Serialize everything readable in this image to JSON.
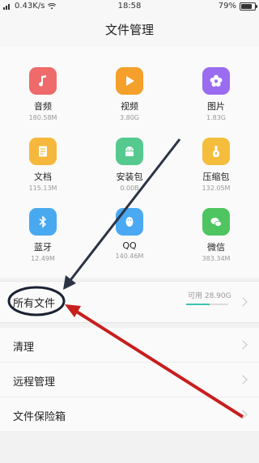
{
  "status_bar": {
    "speed": "0.43K/s",
    "time": "18:58",
    "battery": "79%"
  },
  "title": "文件管理",
  "categories": [
    {
      "label": "音频",
      "size": "180.58M",
      "icon": "music-note-icon",
      "color": "#ef6a6a"
    },
    {
      "label": "视频",
      "size": "3.80G",
      "icon": "play-icon",
      "color": "#f5a02a"
    },
    {
      "label": "图片",
      "size": "1.83G",
      "icon": "flower-icon",
      "color": "#9a6cf0"
    },
    {
      "label": "文档",
      "size": "115.13M",
      "icon": "document-icon",
      "color": "#f5b83c"
    },
    {
      "label": "安装包",
      "size": "0.00B",
      "icon": "android-icon",
      "color": "#56c98f"
    },
    {
      "label": "压缩包",
      "size": "132.05M",
      "icon": "archive-icon",
      "color": "#f4bd3c"
    },
    {
      "label": "蓝牙",
      "size": "12.49M",
      "icon": "bluetooth-icon",
      "color": "#48a9f0"
    },
    {
      "label": "QQ",
      "size": "140.46M",
      "icon": "qq-penguin-icon",
      "color": "#4aa9f2"
    },
    {
      "label": "微信",
      "size": "383.34M",
      "icon": "wechat-icon",
      "color": "#4fc562"
    }
  ],
  "all_files": {
    "label": "所有文件",
    "available": "可用 28.90G",
    "used_fraction": 0.55
  },
  "list": [
    {
      "label": "清理"
    },
    {
      "label": "远程管理"
    },
    {
      "label": "文件保险箱"
    }
  ],
  "annotation_colors": {
    "circle": "#1a2233",
    "arrow_dark": "#2b3444",
    "arrow_red": "#c81e1e"
  }
}
